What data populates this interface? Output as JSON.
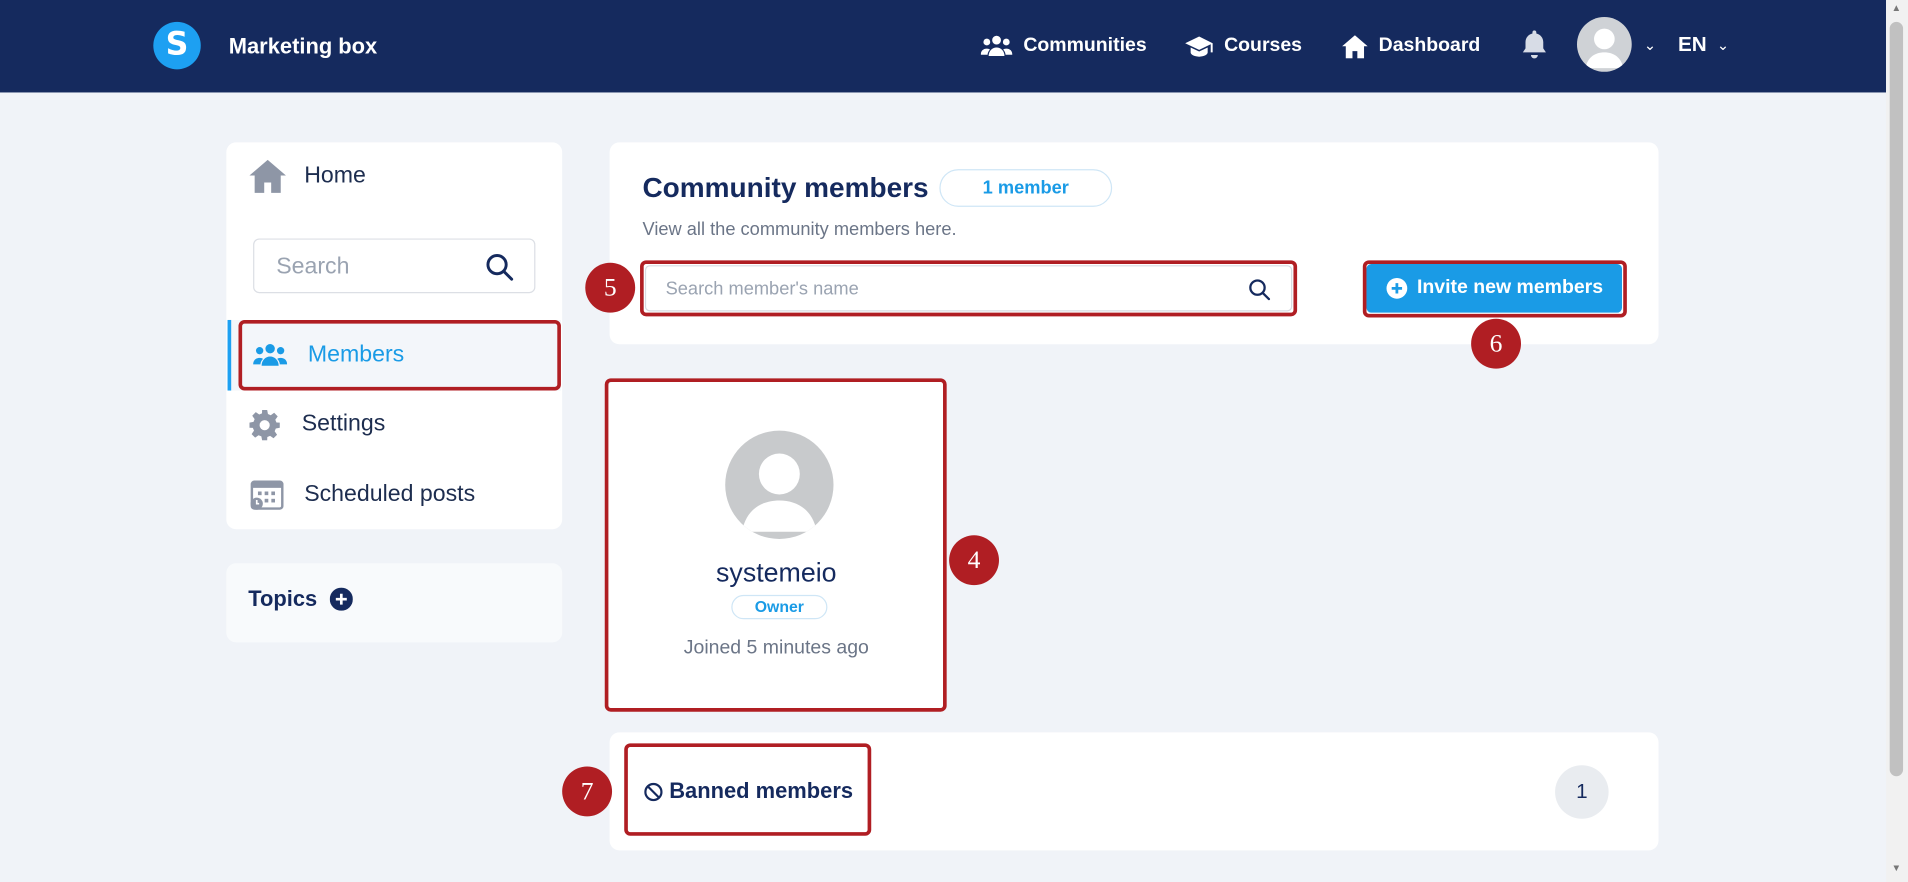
{
  "header": {
    "logo_letter": "S",
    "brand": "Marketing box",
    "nav": [
      {
        "label": "Communities",
        "icon": "users-icon"
      },
      {
        "label": "Courses",
        "icon": "graduation-cap-icon"
      },
      {
        "label": "Dashboard",
        "icon": "home-icon"
      }
    ],
    "language": "EN"
  },
  "sidebar": {
    "home_label": "Home",
    "search_placeholder": "Search",
    "items": [
      {
        "label": "Members",
        "icon": "users-icon",
        "active": true
      },
      {
        "label": "Settings",
        "icon": "gear-icon"
      },
      {
        "label": "Scheduled posts",
        "icon": "calendar-icon"
      }
    ],
    "topics_label": "Topics"
  },
  "members_panel": {
    "title": "Community members",
    "count_badge": "1 member",
    "subtitle": "View all the community members here.",
    "search_placeholder": "Search member's name",
    "invite_label": "Invite new members"
  },
  "member": {
    "name": "systemeio",
    "role": "Owner",
    "joined": "Joined 5 minutes ago"
  },
  "banned": {
    "label": "Banned members",
    "count": "1"
  },
  "annotations": [
    "4",
    "5",
    "6",
    "7"
  ],
  "colors": {
    "header_bg": "#152a5e",
    "accent": "#1a9be6",
    "highlight": "#b01e23"
  }
}
